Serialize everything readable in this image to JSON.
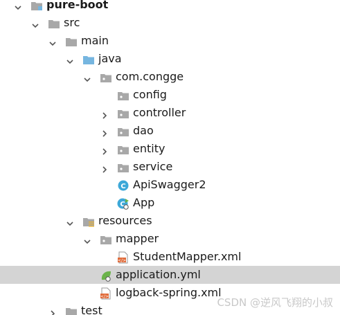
{
  "tree": {
    "items": [
      {
        "label": "pure-boot",
        "level": 0,
        "expanded": true,
        "icon": "module-folder-icon",
        "bold": true
      },
      {
        "label": "src",
        "level": 1,
        "expanded": true,
        "icon": "folder-icon"
      },
      {
        "label": "main",
        "level": 2,
        "expanded": true,
        "icon": "folder-icon"
      },
      {
        "label": "java",
        "level": 3,
        "expanded": true,
        "icon": "source-root-folder-icon"
      },
      {
        "label": "com.congge",
        "level": 4,
        "expanded": true,
        "icon": "package-icon"
      },
      {
        "label": "config",
        "level": 5,
        "expanded": null,
        "icon": "package-icon"
      },
      {
        "label": "controller",
        "level": 5,
        "expanded": false,
        "icon": "package-icon"
      },
      {
        "label": "dao",
        "level": 5,
        "expanded": false,
        "icon": "package-icon"
      },
      {
        "label": "entity",
        "level": 5,
        "expanded": false,
        "icon": "package-icon"
      },
      {
        "label": "service",
        "level": 5,
        "expanded": false,
        "icon": "package-icon"
      },
      {
        "label": "ApiSwagger2",
        "level": 5,
        "expanded": null,
        "icon": "java-class-icon"
      },
      {
        "label": "App",
        "level": 5,
        "expanded": null,
        "icon": "spring-boot-app-icon"
      },
      {
        "label": "resources",
        "level": 3,
        "expanded": true,
        "icon": "resources-folder-icon"
      },
      {
        "label": "mapper",
        "level": 4,
        "expanded": true,
        "icon": "package-icon"
      },
      {
        "label": "StudentMapper.xml",
        "level": 5,
        "expanded": null,
        "icon": "xml-file-icon"
      },
      {
        "label": "application.yml",
        "level": 4,
        "expanded": null,
        "icon": "spring-yml-icon",
        "selected": true
      },
      {
        "label": "logback-spring.xml",
        "level": 4,
        "expanded": null,
        "icon": "xml-file-icon"
      },
      {
        "label": "test",
        "level": 2,
        "expanded": false,
        "icon": "folder-icon"
      }
    ]
  },
  "watermark": "CSDN @逆风飞翔的小叔",
  "colors": {
    "folder": "#a8a8a8",
    "source_root": "#76b6e0",
    "selected_row": "#d4d4d4",
    "java_class": "#3da8d8",
    "xml": "#e06b3a",
    "spring": "#6bb34a"
  }
}
